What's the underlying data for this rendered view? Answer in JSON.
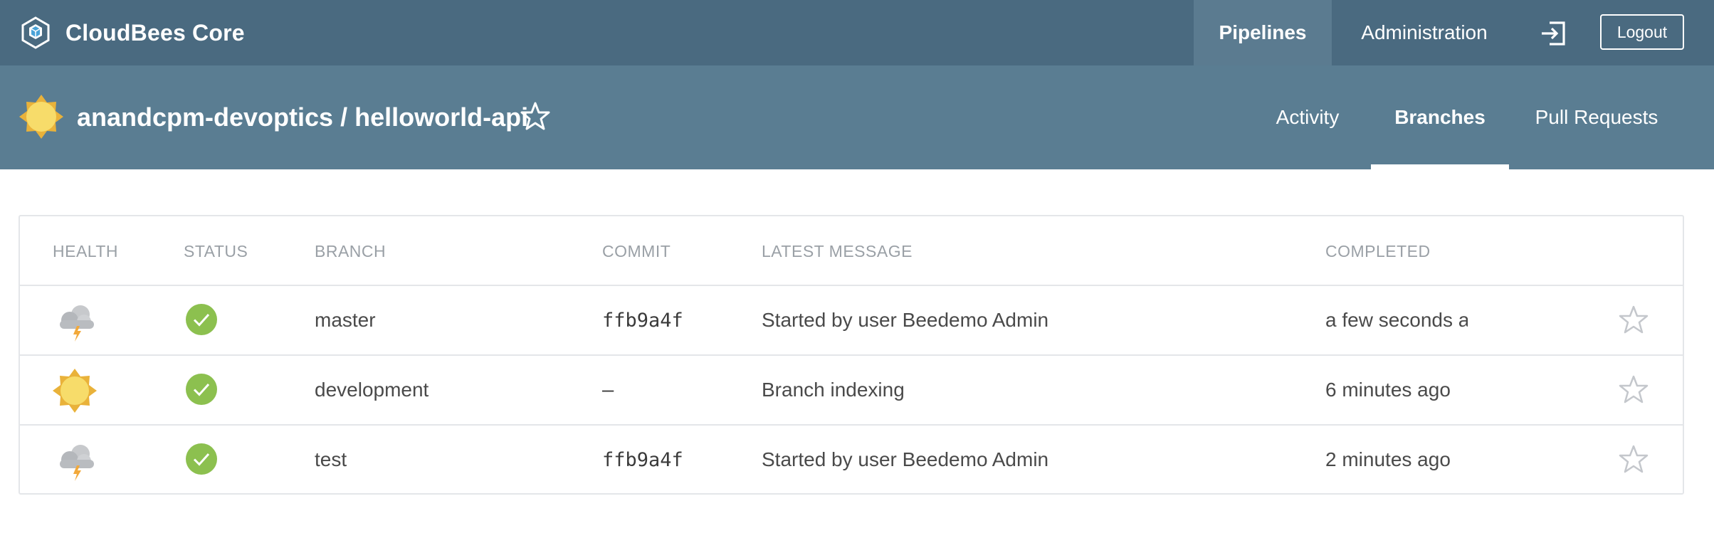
{
  "header": {
    "brand": "CloudBees Core",
    "nav": {
      "pipelines": "Pipelines",
      "administration": "Administration"
    },
    "logout": "Logout"
  },
  "pipeline": {
    "title": "anandcpm-devoptics / helloworld-api",
    "health_icon": "sun-icon",
    "tabs": {
      "activity": "Activity",
      "branches": "Branches",
      "pull_requests": "Pull Requests"
    },
    "active_tab": "Branches"
  },
  "table": {
    "headers": {
      "health": "HEALTH",
      "status": "STATUS",
      "branch": "BRANCH",
      "commit": "COMMIT",
      "message": "LATEST MESSAGE",
      "completed": "COMPLETED"
    },
    "rows": [
      {
        "health": "storm-cloud-icon",
        "status": "success-check-icon",
        "branch": "master",
        "commit": "ffb9a4f",
        "message": "Started by user Beedemo Admin",
        "completed": "a few seconds ago"
      },
      {
        "health": "sun-icon",
        "status": "success-check-icon",
        "branch": "development",
        "commit": "–",
        "message": "Branch indexing",
        "completed": "6 minutes ago"
      },
      {
        "health": "storm-cloud-icon",
        "status": "success-check-icon",
        "branch": "test",
        "commit": "ffb9a4f",
        "message": "Started by user Beedemo Admin",
        "completed": "2 minutes ago"
      }
    ]
  },
  "colors": {
    "header_bg": "#4a6a80",
    "active_nav_bg": "#5b7b90",
    "subheader_bg": "#5a7d92",
    "success": "#8cc04f",
    "sun": "#f6d65f",
    "border": "#e4e6e9"
  }
}
